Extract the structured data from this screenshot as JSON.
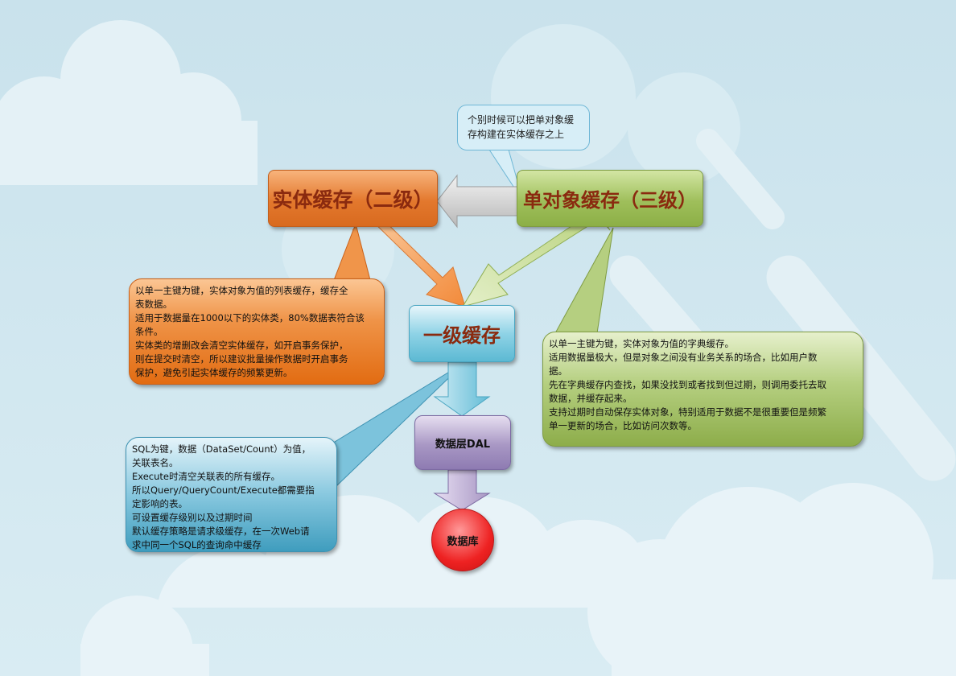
{
  "nodes": {
    "entity_cache": "实体缓存（二级）",
    "single_object_cache": "单对象缓存（三级）",
    "first_level_cache": "一级缓存",
    "data_layer": "数据层DAL",
    "database": "数据库"
  },
  "callout": {
    "lines": [
      "个别时候可以把单对象缓",
      "存构建在实体缓存之上"
    ]
  },
  "notes": {
    "entity": [
      "以单一主键为键，实体对象为值的列表缓存，缓存全",
      "表数据。",
      "适用于数据量在1000以下的实体类，80%数据表符合该",
      "条件。",
      "实体类的增删改会清空实体缓存，如开启事务保护，",
      "则在提交时清空，所以建议批量操作数据时开启事务",
      "保护，避免引起实体缓存的频繁更新。"
    ],
    "single_object": [
      "以单一主键为键，实体对象为值的字典缓存。",
      "适用数据量极大，但是对象之间没有业务关系的场合，比如用户数",
      "据。",
      "先在字典缓存内查找，如果没找到或者找到但过期，则调用委托去取",
      "数据，并缓存起来。",
      "支持过期时自动保存实体对象，特别适用于数据不是很重要但是频繁",
      "单一更新的场合，比如访问次数等。"
    ],
    "first_level": [
      "SQL为键，数据（DataSet/Count）为值，",
      "关联表名。",
      "Execute时清空关联表的所有缓存。",
      "所以Query/QueryCount/Execute都需要指",
      "定影响的表。",
      "可设置缓存级别以及过期时间",
      "默认缓存策略是请求级缓存，在一次Web请",
      "求中同一个SQL的查询命中缓存"
    ]
  },
  "colors": {
    "orange": "#e3782d",
    "green": "#9fbf5b",
    "blue": "#5cb9d3",
    "purple": "#a897c4",
    "red": "#ee2222",
    "title_text": "#8a2a0f"
  }
}
